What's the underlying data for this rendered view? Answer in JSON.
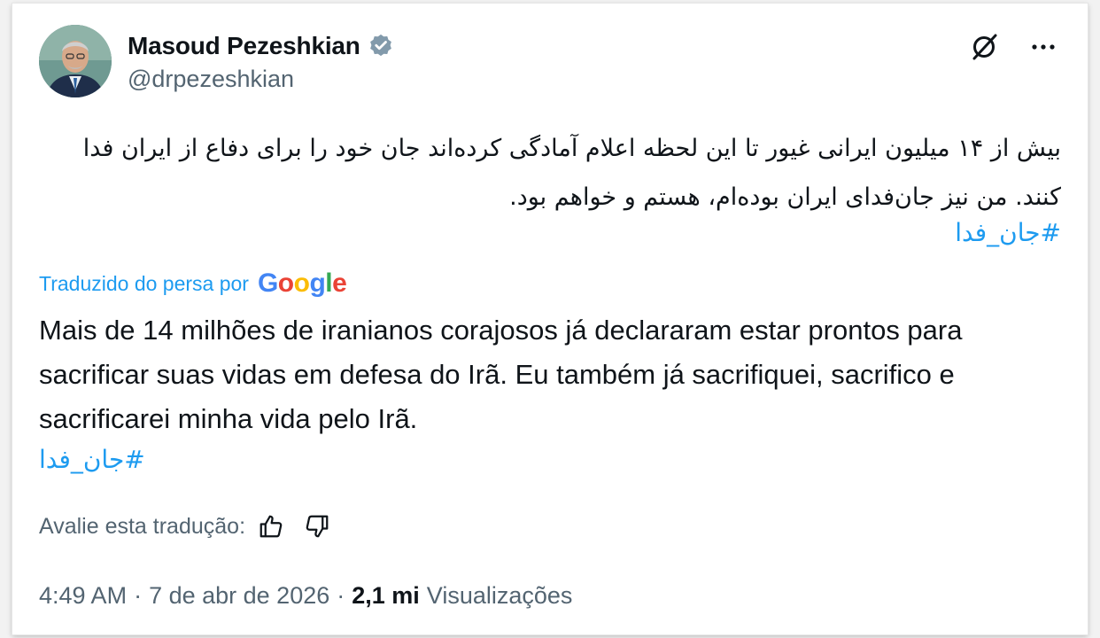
{
  "author": {
    "display_name": "Masoud Pezeshkian",
    "handle": "@drpezeshkian",
    "verified": true,
    "avatar_icon": "profile-photo"
  },
  "tweet": {
    "original_text": "بیش از ۱۴ میلیون ایرانی غیور تا این لحظه اعلام آمادگی کرده‌اند جان خود را برای دفاع از ایران فدا کنند. من نیز جان‌فدای ایران بوده‌ام، هستم و خواهم بود.",
    "original_hashtag": "#جان_فدا",
    "translation_label": "Traduzido do persa por",
    "translation_provider": "Google",
    "translated_text": "Mais de 14 milhões de iranianos corajosos já declararam estar prontos para sacrificar suas vidas em defesa do Irã. Eu também já sacrifiquei, sacrifico e sacrificarei minha vida pelo Irã.",
    "translated_hashtag": "#جان_فدا",
    "rate_label": "Avalie esta tradução:"
  },
  "meta": {
    "time": "4:49 AM",
    "separator": "·",
    "date": "7 de abr de 2026",
    "views_count": "2,1 mi",
    "views_label": "Visualizações"
  },
  "icons": {
    "verified": "verified-badge-icon",
    "grok": "grok-icon",
    "more": "more-icon",
    "thumbs_up": "thumbs-up-icon",
    "thumbs_down": "thumbs-down-icon"
  },
  "colors": {
    "text": "#0f1419",
    "secondary": "#536471",
    "link": "#1d9bf0",
    "verified": "#829aab",
    "google_blue": "#4285F4",
    "google_red": "#EA4335",
    "google_yellow": "#FBBC05",
    "google_green": "#34A853"
  }
}
